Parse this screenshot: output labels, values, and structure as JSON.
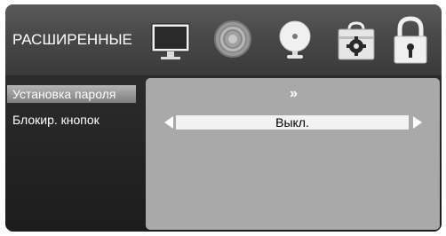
{
  "header": {
    "title": "РАСШИРЕННЫЕ",
    "icons": [
      "monitor-icon",
      "sound-icon",
      "satellite-dish-icon",
      "toolbox-settings-icon",
      "padlock-icon"
    ]
  },
  "menu": {
    "items": [
      {
        "label": "Установка пароля",
        "selected": true
      },
      {
        "label": "Блокир. кнопок",
        "selected": false
      }
    ]
  },
  "content": {
    "submenu_arrow": "»",
    "lock_keys_value": "Выкл."
  },
  "colors": {
    "header_bg": "#4a4a4a",
    "body_bg": "#2a2a2a",
    "content_bg": "#a9a9a9",
    "selection": "#9a9a9a",
    "value_bg": "#f2f2f2"
  }
}
